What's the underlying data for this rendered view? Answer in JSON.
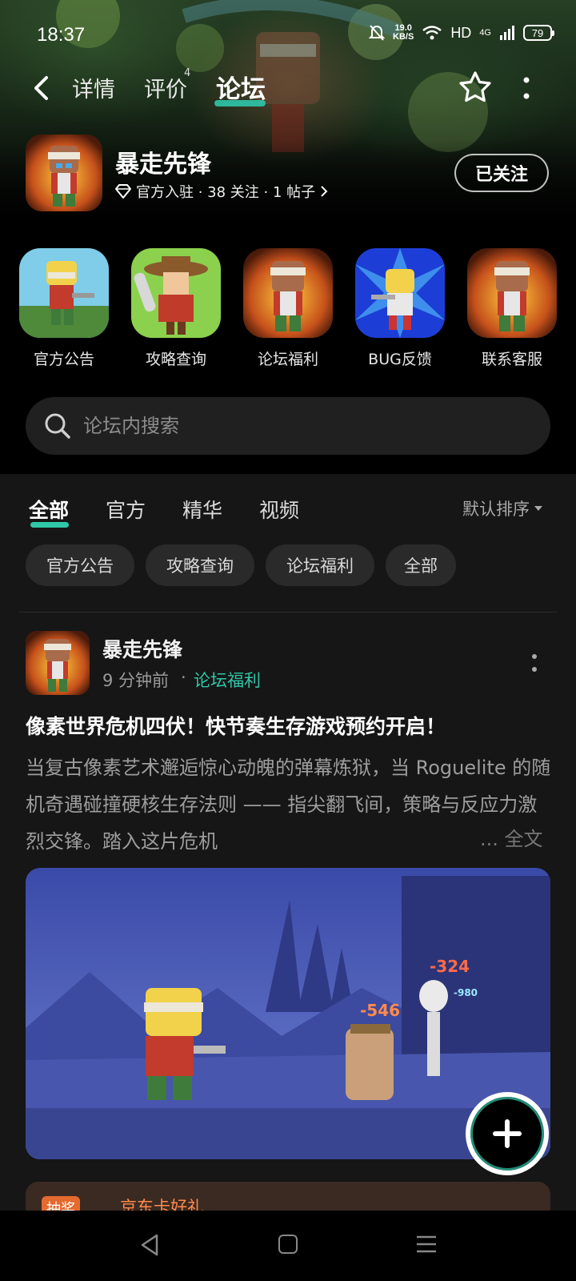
{
  "status_bar": {
    "time": "18:37",
    "net_speed_value": "19.0",
    "net_speed_unit": "KB/S",
    "hd_label": "HD",
    "network_label": "4G",
    "battery": "79"
  },
  "nav": {
    "tabs": [
      {
        "label": "详情"
      },
      {
        "label": "评价",
        "badge": "4"
      },
      {
        "label": "论坛"
      }
    ],
    "active_tab": "论坛"
  },
  "game": {
    "title": "暴走先锋",
    "meta": "官方入驻 · 38 关注 · 1 帖子",
    "follow_label": "已关注"
  },
  "shortcuts": [
    {
      "label": "官方公告"
    },
    {
      "label": "攻略查询"
    },
    {
      "label": "论坛福利"
    },
    {
      "label": "BUG反馈"
    },
    {
      "label": "联系客服"
    }
  ],
  "search": {
    "placeholder": "论坛内搜索"
  },
  "filter_tabs": [
    {
      "label": "全部"
    },
    {
      "label": "官方"
    },
    {
      "label": "精华"
    },
    {
      "label": "视频"
    }
  ],
  "sort_label": "默认排序",
  "chips": [
    {
      "label": "官方公告"
    },
    {
      "label": "攻略查询"
    },
    {
      "label": "论坛福利"
    },
    {
      "label": "全部"
    }
  ],
  "post": {
    "author": "暴走先锋",
    "time": "9 分钟前",
    "category": "论坛福利",
    "title": "像素世界危机四伏！快节奏生存游戏预约开启！",
    "body": "当复古像素艺术邂逅惊心动魄的弹幕炼狱，当 Roguelite 的随机奇遇碰撞硬核生存法则 —— 指尖翻飞间，策略与反应力激烈交锋。踏入这片危机",
    "full_text_link": "... 全文",
    "image_damage_numbers": [
      "-324",
      "-980",
      "-546"
    ]
  },
  "promo": {
    "badge": "抽奖",
    "text": "京东卡好礼"
  },
  "colors": {
    "accent": "#2fc7a8",
    "panel_bg": "#161616",
    "chip_bg": "#2a2a2a"
  }
}
